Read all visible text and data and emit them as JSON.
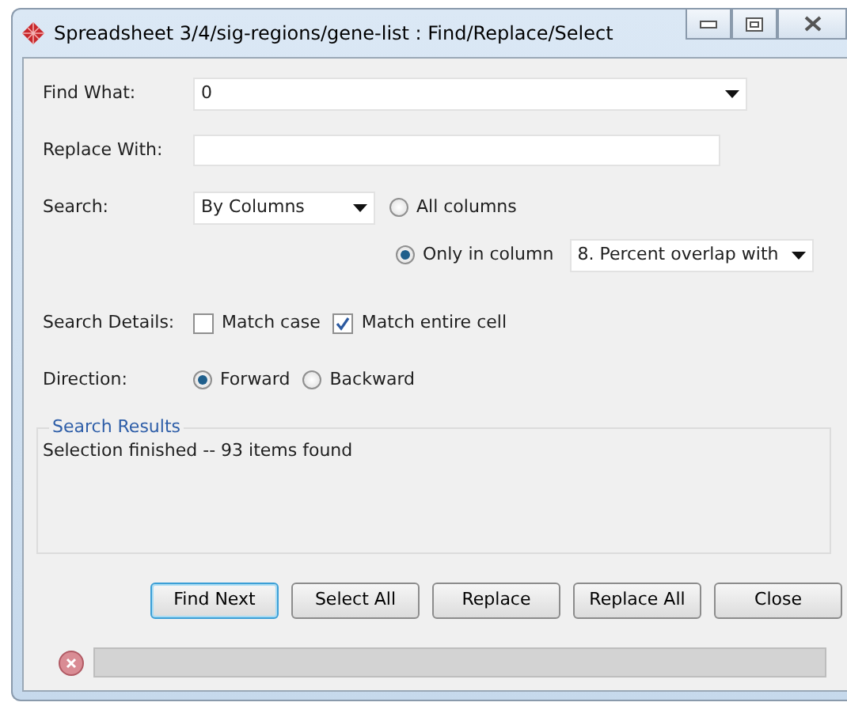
{
  "window": {
    "title": "Spreadsheet 3/4/sig-regions/gene-list : Find/Replace/Select"
  },
  "find_what": {
    "label": "Find What:",
    "value": "0"
  },
  "replace_with": {
    "label": "Replace With:"
  },
  "search": {
    "label": "Search:",
    "mode": "By Columns",
    "scopes": [
      {
        "label": "All columns",
        "selected": false
      },
      {
        "label": "Only in column",
        "selected": true
      }
    ],
    "column": "8. Percent overlap with"
  },
  "search_details": {
    "label": "Search Details:",
    "options": [
      {
        "label": "Match case",
        "checked": false
      },
      {
        "label": "Match entire cell",
        "checked": true
      }
    ]
  },
  "direction": {
    "label": "Direction:",
    "options": [
      {
        "label": "Forward",
        "selected": true
      },
      {
        "label": "Backward",
        "selected": false
      }
    ]
  },
  "search_results": {
    "title": "Search Results",
    "message": "Selection finished -- 93 items found"
  },
  "buttons": [
    {
      "label": "Find Next",
      "focused": true
    },
    {
      "label": "Select All",
      "focused": false
    },
    {
      "label": "Replace",
      "focused": false
    },
    {
      "label": "Replace All",
      "focused": false
    },
    {
      "label": "Close",
      "focused": false
    }
  ]
}
